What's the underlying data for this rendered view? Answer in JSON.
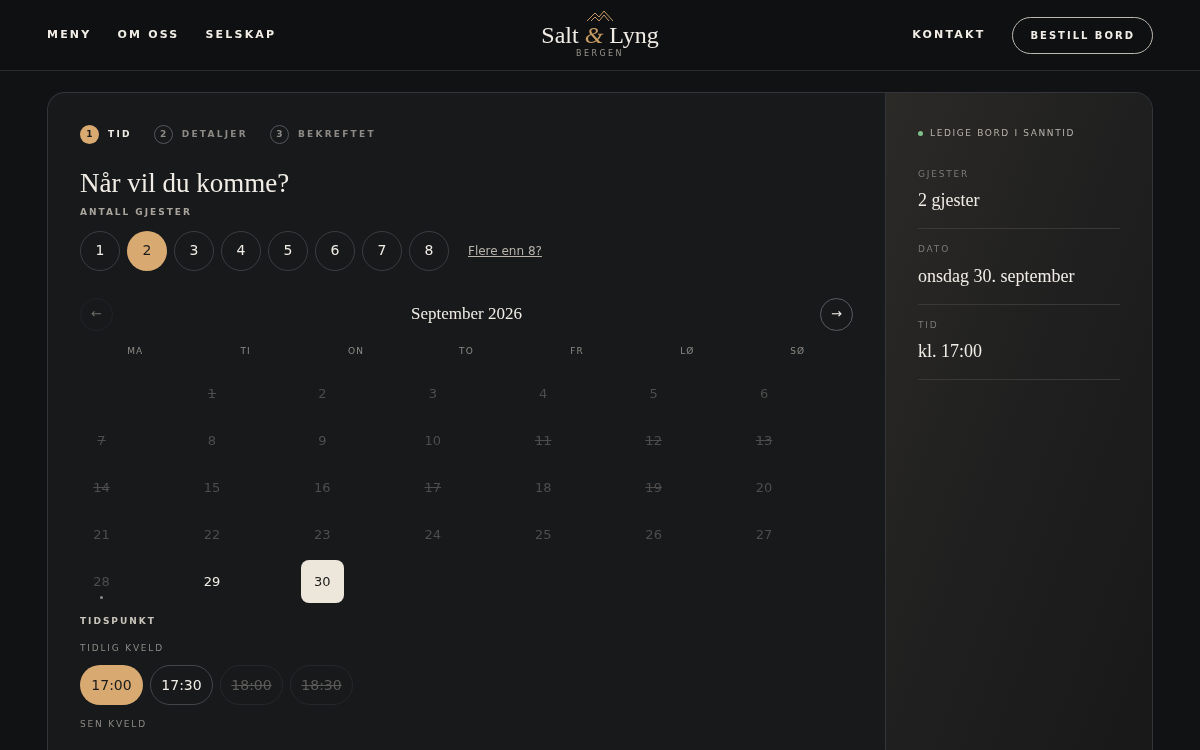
{
  "nav": {
    "left": [
      "MENY",
      "OM OSS",
      "SELSKAP"
    ],
    "logo": {
      "first": "Salt",
      "amp": "&",
      "second": "Lyng",
      "sub": "BERGEN"
    },
    "right": "KONTAKT",
    "cta": "BESTILL BORD"
  },
  "steps": [
    {
      "number": "1",
      "label": "TID",
      "selected": true
    },
    {
      "number": "2",
      "label": "DETALJER",
      "selected": false
    },
    {
      "number": "3",
      "label": "BEKREFTET",
      "selected": false
    }
  ],
  "heading": "Når vil du komme?",
  "guests": {
    "label": "ANTALL GJESTER",
    "options": [
      {
        "label": "1",
        "selected": false
      },
      {
        "label": "2",
        "selected": true
      },
      {
        "label": "3",
        "selected": false
      },
      {
        "label": "4",
        "selected": false
      },
      {
        "label": "5",
        "selected": false
      },
      {
        "label": "6",
        "selected": false
      },
      {
        "label": "7",
        "selected": false
      },
      {
        "label": "8",
        "selected": false
      }
    ],
    "more_link": "Flere enn 8?"
  },
  "calendar": {
    "prev": "←",
    "next": "→",
    "prev_disabled": true,
    "month": "September 2026",
    "weekdays": [
      "MA",
      "TI",
      "ON",
      "TO",
      "FR",
      "LØ",
      "SØ"
    ],
    "days": [
      {
        "label": "1",
        "kind": "full",
        "selected": false,
        "today": false
      },
      {
        "label": "2",
        "kind": "past",
        "selected": false,
        "today": false
      },
      {
        "label": "3",
        "kind": "past",
        "selected": false,
        "today": false
      },
      {
        "label": "4",
        "kind": "past",
        "selected": false,
        "today": false
      },
      {
        "label": "5",
        "kind": "past",
        "selected": false,
        "today": false
      },
      {
        "label": "6",
        "kind": "past",
        "selected": false,
        "today": false
      },
      {
        "label": "7",
        "kind": "full",
        "selected": false,
        "today": false
      },
      {
        "label": "8",
        "kind": "past",
        "selected": false,
        "today": false
      },
      {
        "label": "9",
        "kind": "past",
        "selected": false,
        "today": false
      },
      {
        "label": "10",
        "kind": "past",
        "selected": false,
        "today": false
      },
      {
        "label": "11",
        "kind": "full",
        "selected": false,
        "today": false
      },
      {
        "label": "12",
        "kind": "full",
        "selected": false,
        "today": false
      },
      {
        "label": "13",
        "kind": "full",
        "selected": false,
        "today": false
      },
      {
        "label": "14",
        "kind": "full",
        "selected": false,
        "today": false
      },
      {
        "label": "15",
        "kind": "past",
        "selected": false,
        "today": false
      },
      {
        "label": "16",
        "kind": "past",
        "selected": false,
        "today": false
      },
      {
        "label": "17",
        "kind": "full",
        "selected": false,
        "today": false
      },
      {
        "label": "18",
        "kind": "past",
        "selected": false,
        "today": false
      },
      {
        "label": "19",
        "kind": "full",
        "selected": false,
        "today": false
      },
      {
        "label": "20",
        "kind": "past",
        "selected": false,
        "today": false
      },
      {
        "label": "21",
        "kind": "past",
        "selected": false,
        "today": false
      },
      {
        "label": "22",
        "kind": "past",
        "selected": false,
        "today": false
      },
      {
        "label": "23",
        "kind": "past",
        "selected": false,
        "today": false
      },
      {
        "label": "24",
        "kind": "past",
        "selected": false,
        "today": false
      },
      {
        "label": "25",
        "kind": "past",
        "selected": false,
        "today": false
      },
      {
        "label": "26",
        "kind": "past",
        "selected": false,
        "today": false
      },
      {
        "label": "27",
        "kind": "past",
        "selected": false,
        "today": false
      },
      {
        "label": "28",
        "kind": "past",
        "selected": false,
        "today": true
      },
      {
        "label": "29",
        "kind": "open",
        "selected": false,
        "today": false
      },
      {
        "label": "30",
        "kind": "open",
        "selected": true,
        "today": false
      }
    ]
  },
  "times": {
    "label": "TIDSPUNKT",
    "groups": [
      {
        "label": "TIDLIG KVELD",
        "slots": [
          {
            "label": "17:00",
            "selected": true,
            "full": false
          },
          {
            "label": "17:30",
            "selected": false,
            "full": false
          },
          {
            "label": "18:00",
            "selected": false,
            "full": true
          },
          {
            "label": "18:30",
            "selected": false,
            "full": true
          }
        ]
      },
      {
        "label": "SEN KVELD"
      }
    ]
  },
  "summary": {
    "live": "LEDIGE BORD I SANNTID",
    "items": [
      {
        "label": "GJESTER",
        "value": "2 gjester"
      },
      {
        "label": "DATO",
        "value": "onsdag 30. september"
      },
      {
        "label": "TID",
        "value": "kl. 17:00"
      }
    ]
  }
}
